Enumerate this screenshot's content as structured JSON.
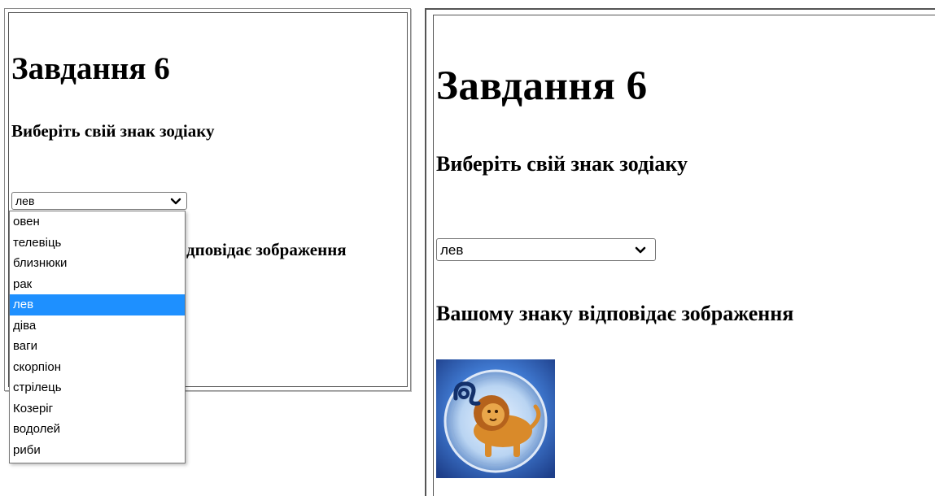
{
  "left": {
    "title": "Завдання 6",
    "prompt": "Виберіть свій знак зодіаку",
    "select_value": "лев",
    "result_heading_visible": "дповідає зображення",
    "options": [
      "овен",
      "телевіць",
      "близнюки",
      "рак",
      "лев",
      "діва",
      "ваги",
      "скорпіон",
      "стрілець",
      "Козеріг",
      "водолей",
      "риби"
    ],
    "selected_index": 4
  },
  "right": {
    "title": "Завдання 6",
    "prompt": "Виберіть свій знак зодіаку",
    "select_value": "лев",
    "result_heading": "Вашому знаку відповідає зображення",
    "image_icon": "leo-zodiac-lion-icon"
  },
  "colors": {
    "selected_option_bg": "#1e90ff",
    "image_bg": "#3a6fc8",
    "lion": "#d98a2a"
  }
}
